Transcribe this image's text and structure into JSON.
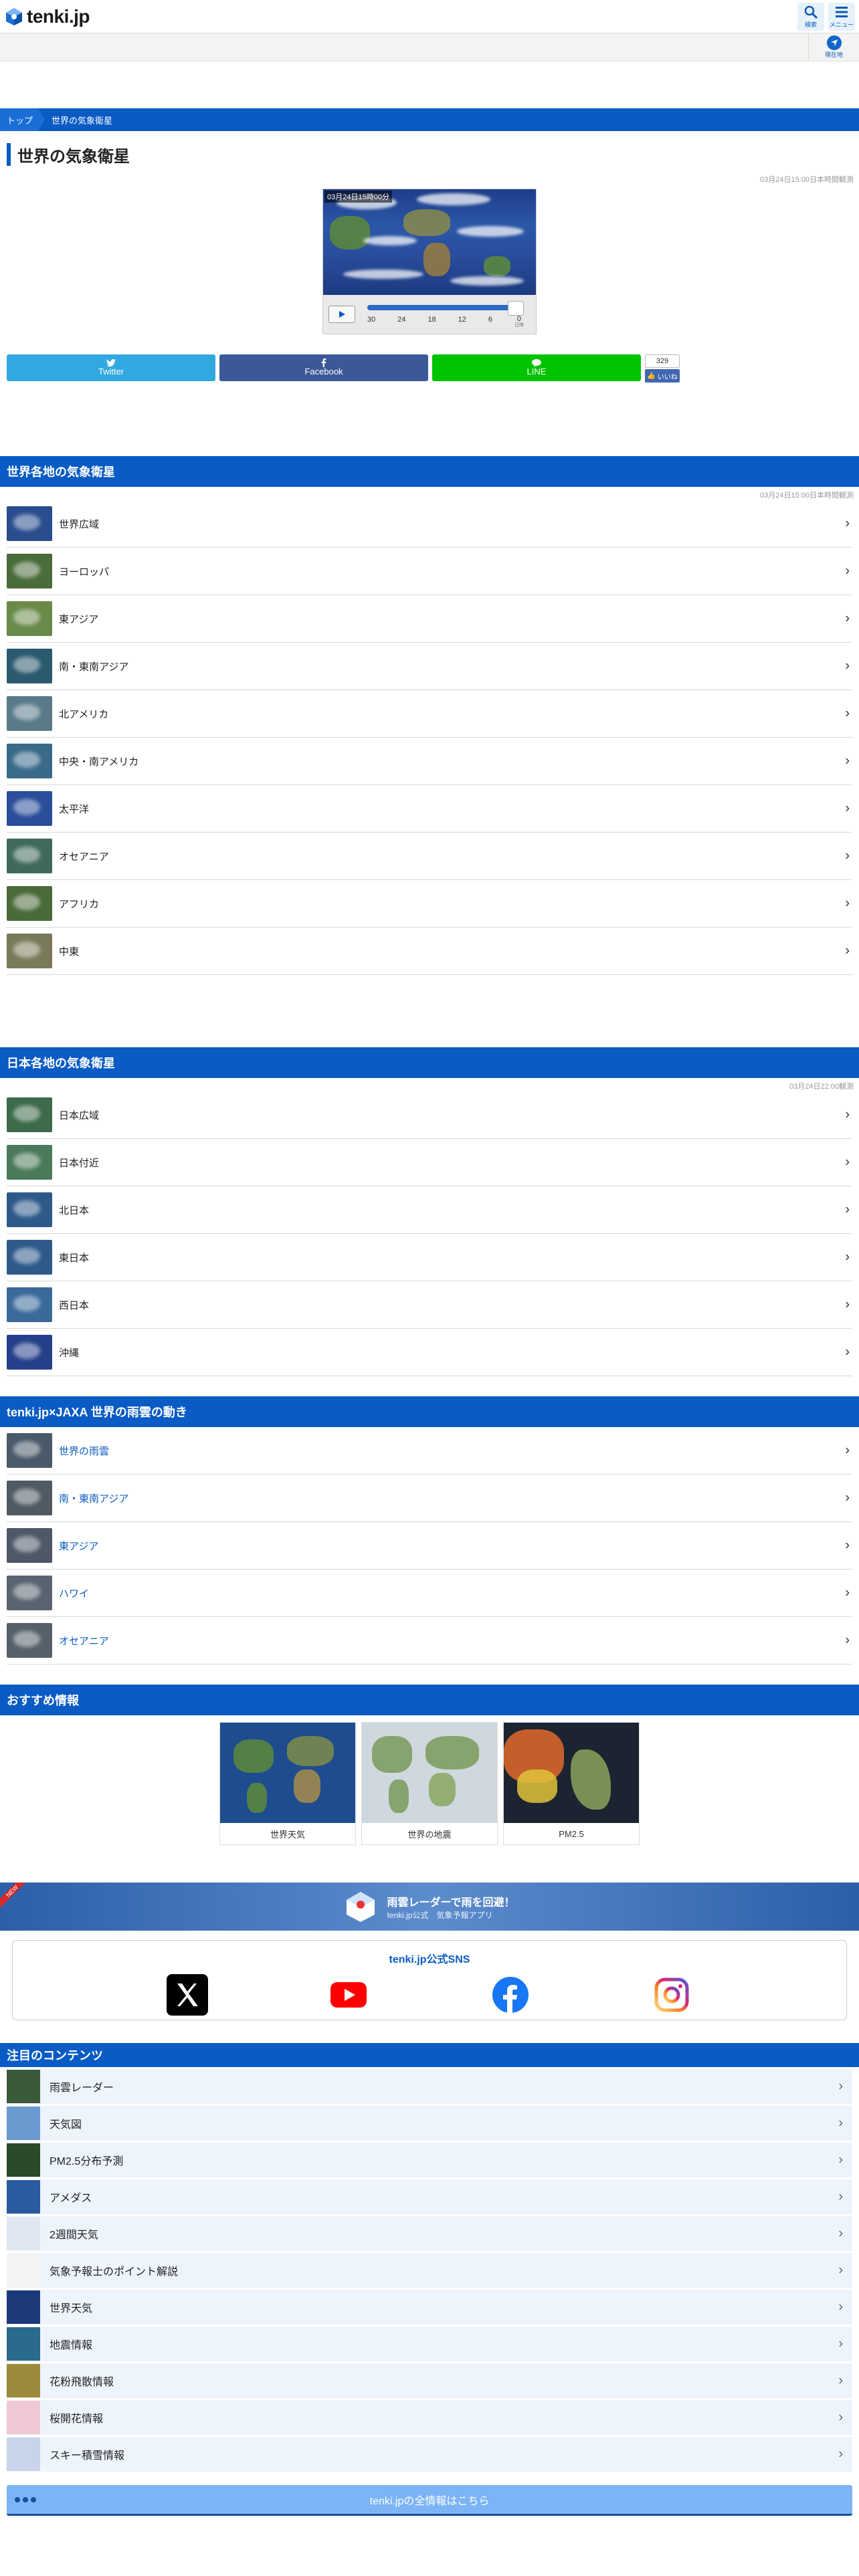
{
  "header": {
    "logo_text": "tenki.jp",
    "search_label": "検索",
    "menu_label": "メニュー",
    "current_location_label": "現在地"
  },
  "breadcrumb": {
    "home": "トップ",
    "current": "世界の気象衛星"
  },
  "page": {
    "title": "世界の気象衛星",
    "timestamp": "03月24日15:00日本時間観測"
  },
  "player": {
    "stamp": "03月24日15時00分",
    "ticks": [
      "30",
      "24",
      "18",
      "12",
      "6",
      "0"
    ],
    "tick_sub": "日時",
    "progress": 1.0
  },
  "share": {
    "twitter": "Twitter",
    "facebook": "Facebook",
    "line": "LINE",
    "like_count": "329",
    "like_label": "いいね"
  },
  "world_section": {
    "title": "世界各地の気象衛星",
    "timestamp": "03月24日15:00日本時間観測",
    "items": [
      "世界広域",
      "ヨーロッパ",
      "東アジア",
      "南・東南アジア",
      "北アメリカ",
      "中央・南アメリカ",
      "太平洋",
      "オセアニア",
      "アフリカ",
      "中東"
    ]
  },
  "japan_section": {
    "title": "日本各地の気象衛星",
    "timestamp": "03月24日22:00観測",
    "items": [
      "日本広域",
      "日本付近",
      "北日本",
      "東日本",
      "西日本",
      "沖縄"
    ]
  },
  "jaxa_section": {
    "title": "tenki.jp×JAXA 世界の雨雲の動き",
    "items": [
      "世界の雨雲",
      "南・東南アジア",
      "東アジア",
      "ハワイ",
      "オセアニア"
    ]
  },
  "recommend": {
    "title": "おすすめ情報",
    "cards": [
      "世界天気",
      "世界の地震",
      "PM2.5"
    ]
  },
  "banner": {
    "ribbon": "NEW",
    "line1": "雨雲レーダーで雨を回避！",
    "line2": "tenki.jp公式　気象予報アプリ"
  },
  "sns": {
    "title": "tenki.jp公式SNS"
  },
  "featured": {
    "title": "注目のコンテンツ",
    "items": [
      "雨雲レーダー",
      "天気図",
      "PM2.5分布予測",
      "アメダス",
      "2週間天気",
      "気象予報士のポイント解説",
      "世界天気",
      "地震情報",
      "花粉飛散情報",
      "桜開花情報",
      "スキー積雪情報"
    ]
  },
  "all_info_button": "tenki.jpの全情報はこちら",
  "colors": {
    "brand_blue": "#0a5bc4",
    "twitter": "#31a8e0",
    "facebook": "#3b5998",
    "line": "#00c300"
  }
}
